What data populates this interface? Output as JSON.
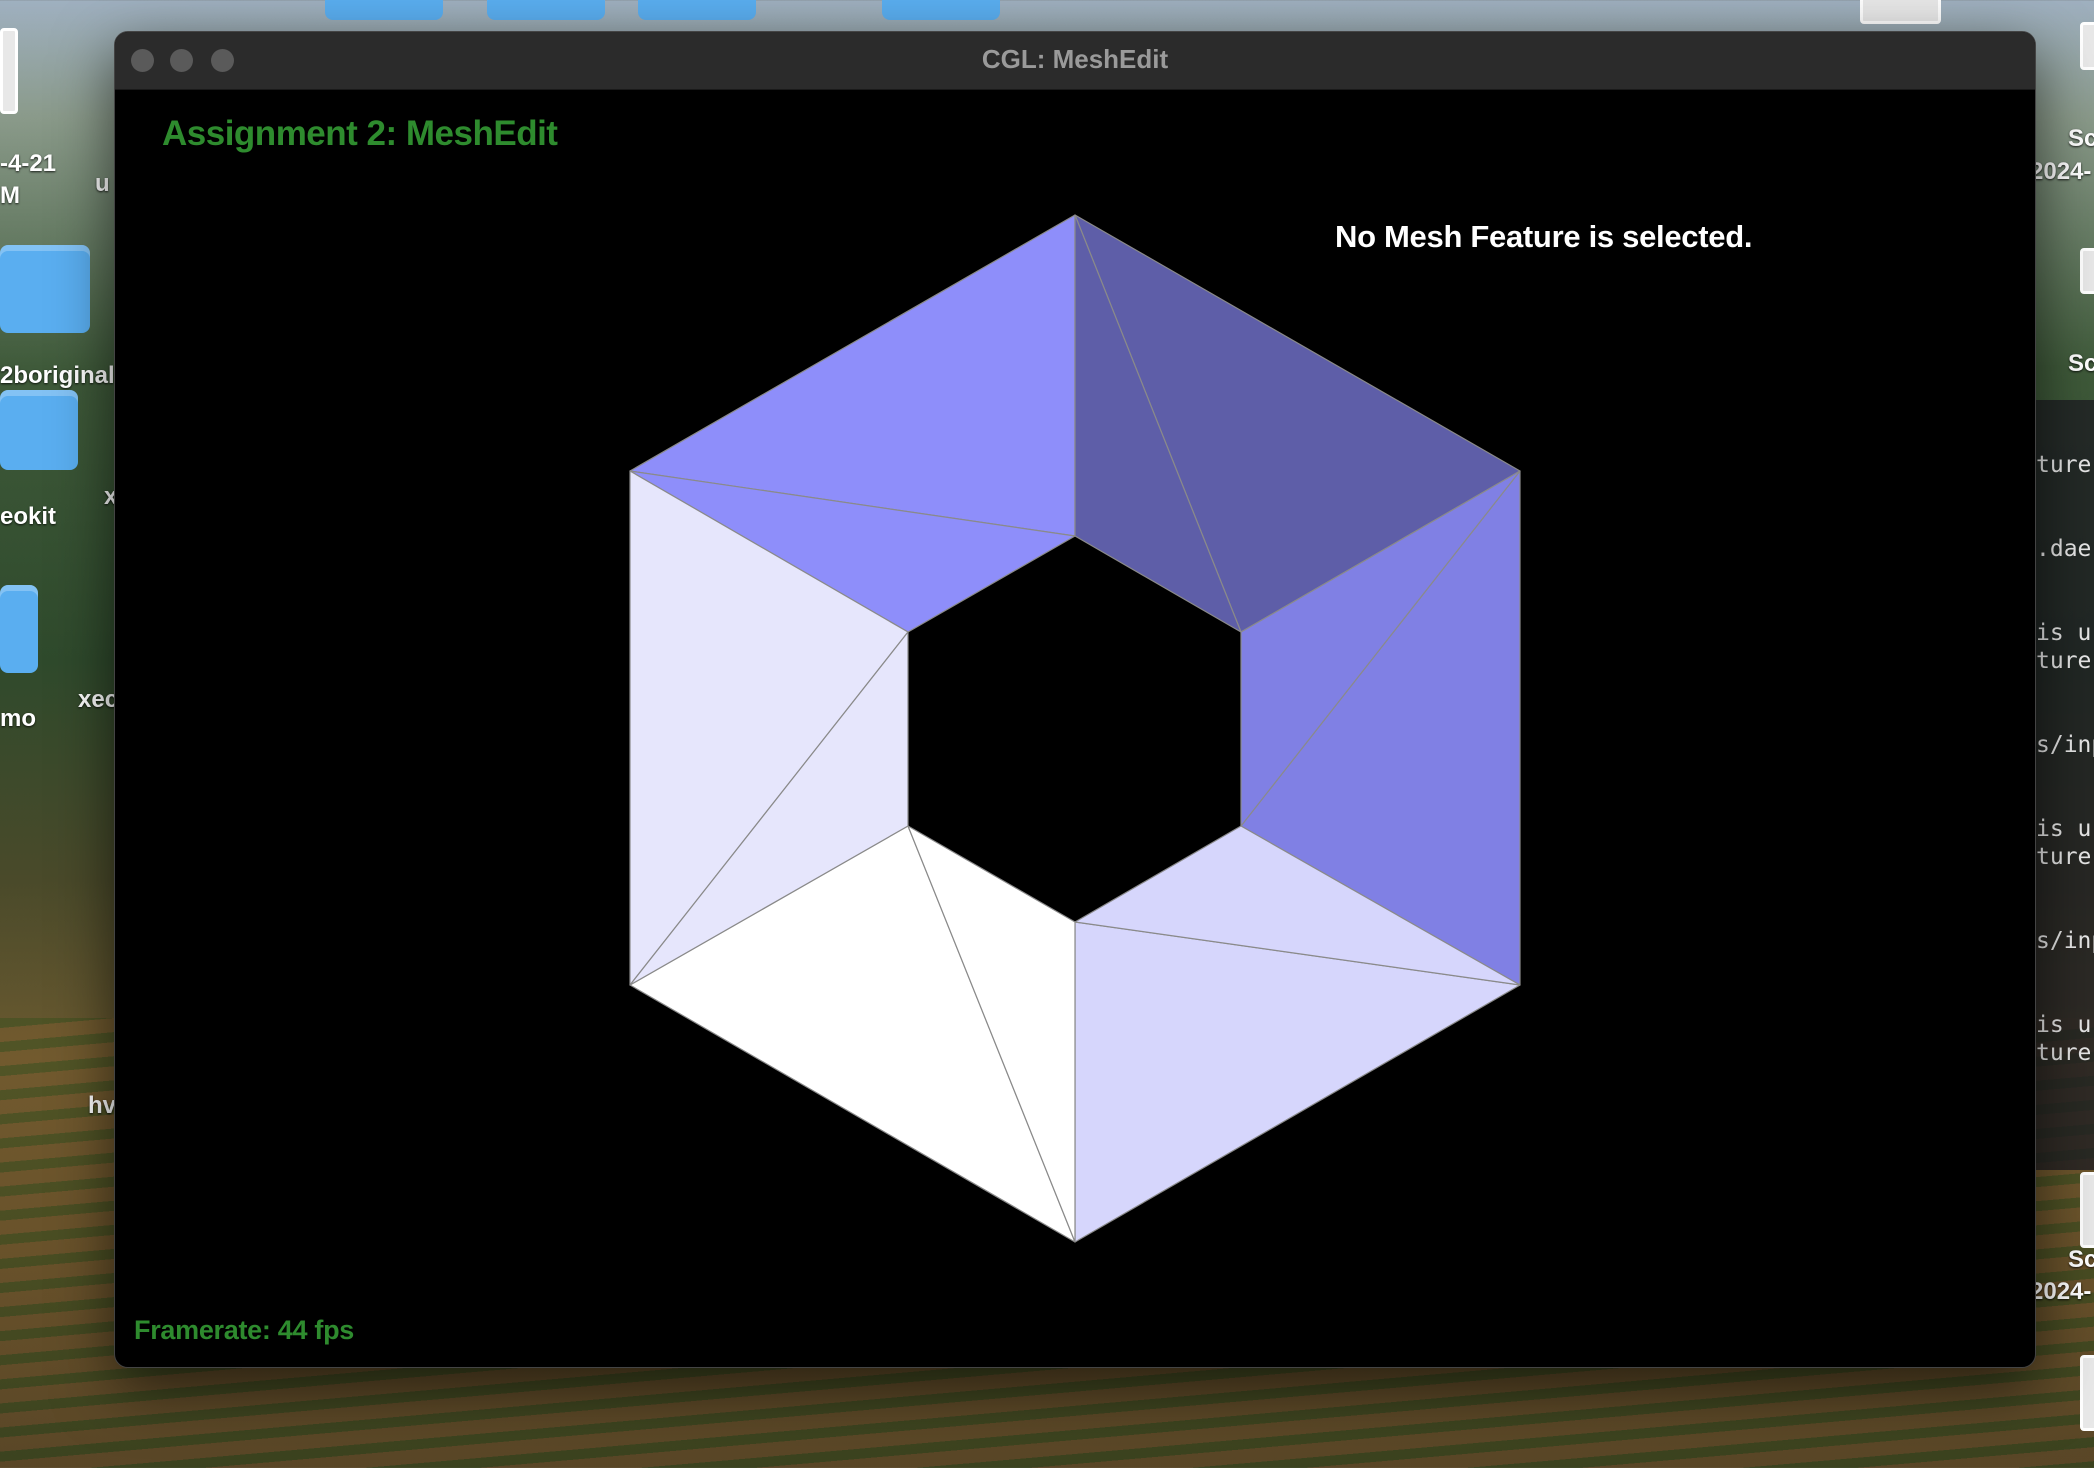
{
  "window": {
    "title": "CGL: MeshEdit"
  },
  "app": {
    "heading": "Assignment 2: MeshEdit",
    "selection_status": "No Mesh Feature is selected.",
    "framerate": "Framerate: 44 fps"
  },
  "desktop": {
    "left_labels": [
      "-4-21",
      "M",
      "2boriginal",
      "eokit",
      "mo",
      "u",
      "x",
      "xec",
      "hv"
    ],
    "right_labels": [
      "Sc",
      "2024-",
      "Sc",
      "Sc",
      "2024-"
    ],
    "terminal_lines": [
      "ture",
      ".dae",
      "is ur",
      "ture",
      "s/inp",
      "is ur",
      "ture",
      "s/inp",
      "is ur",
      "ture"
    ]
  },
  "colors": {
    "accent_green": "#2e8b2e",
    "mesh_top": "#8e8efa",
    "mesh_top_right": "#5e5ea8",
    "mesh_right": "#8080e4",
    "mesh_bottom_right": "#d6d6fc",
    "mesh_bottom_left": "#ffffff",
    "mesh_left": "#e6e6fc"
  }
}
